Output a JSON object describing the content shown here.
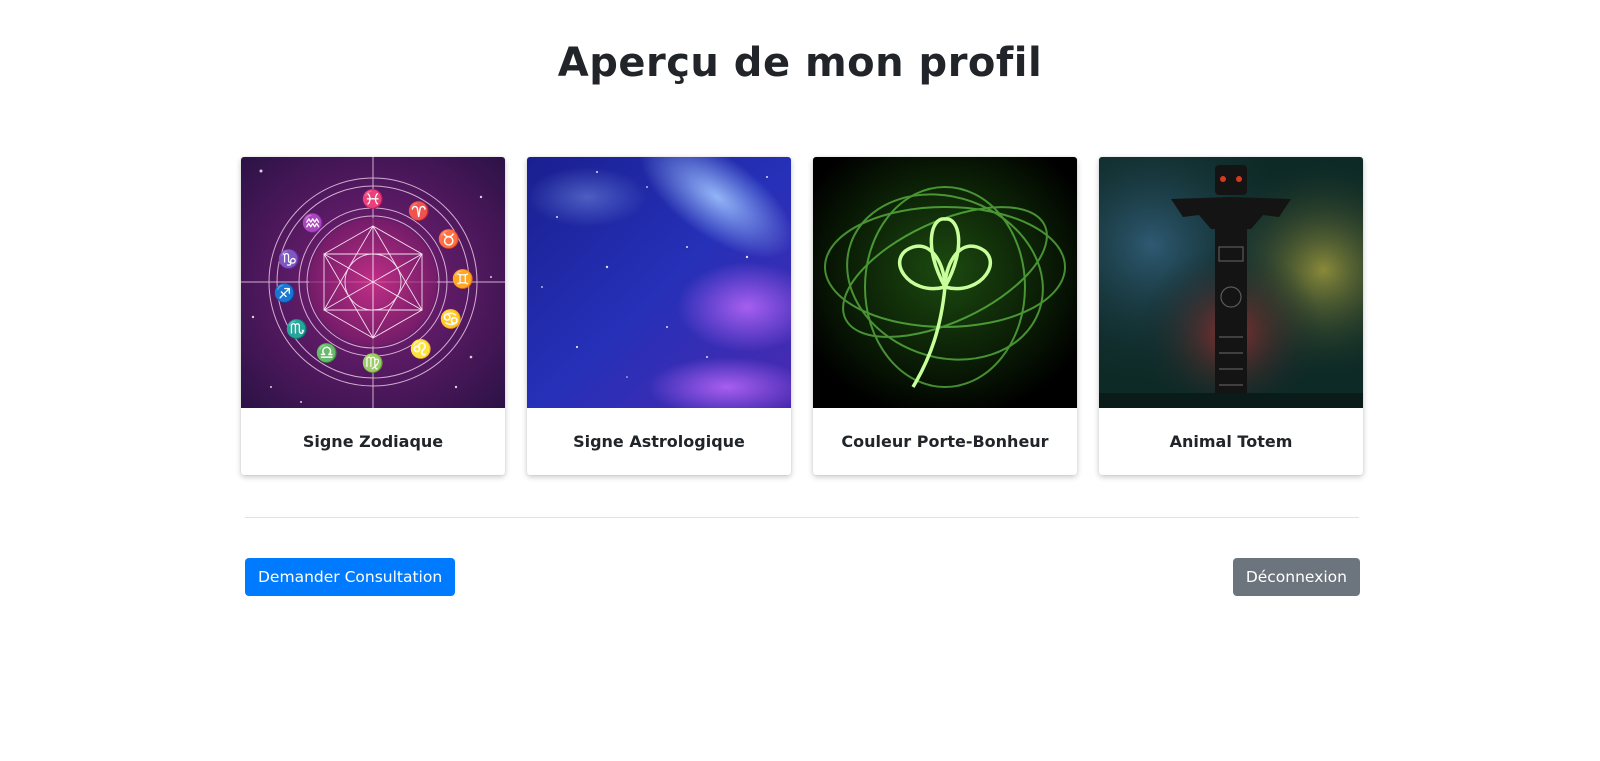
{
  "page": {
    "title": "Aperçu de mon profil"
  },
  "cards": [
    {
      "label": "Signe Zodiaque",
      "image": "zodiac-wheel-image"
    },
    {
      "label": "Signe Astrologique",
      "image": "galaxy-nebula-image"
    },
    {
      "label": "Couleur Porte-Bonheur",
      "image": "green-clover-light-image"
    },
    {
      "label": "Animal Totem",
      "image": "totem-pole-image"
    }
  ],
  "actions": {
    "consultation_label": "Demander Consultation",
    "logout_label": "Déconnexion"
  },
  "colors": {
    "primary": "#007bff",
    "secondary": "#6c757d",
    "divider": "#dee2e6"
  }
}
